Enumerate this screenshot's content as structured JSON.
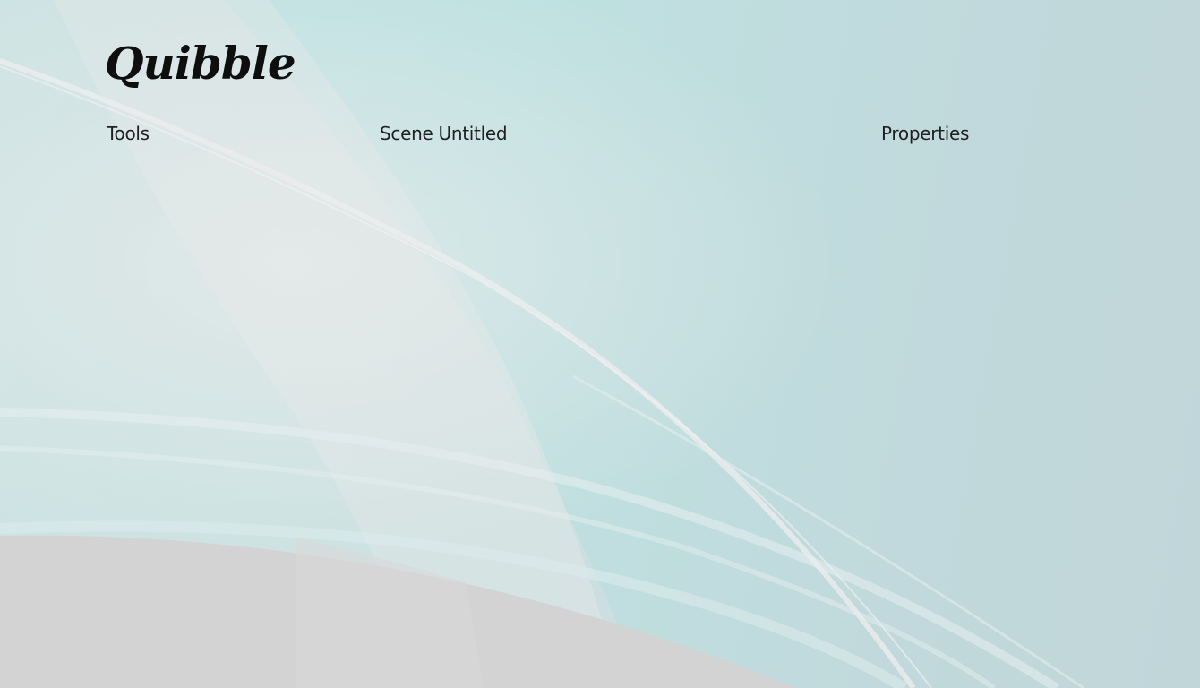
{
  "app": {
    "title": "Quibble"
  },
  "panels": {
    "tools": {
      "heading": "Tools"
    },
    "scene": {
      "heading": "Scene Untitled"
    },
    "properties": {
      "heading": "Properties"
    }
  },
  "theme": {
    "background": "#c0dfe0",
    "accent_light": "#e8e8e8",
    "floor": "#d3d3d3",
    "text": "#111111"
  }
}
